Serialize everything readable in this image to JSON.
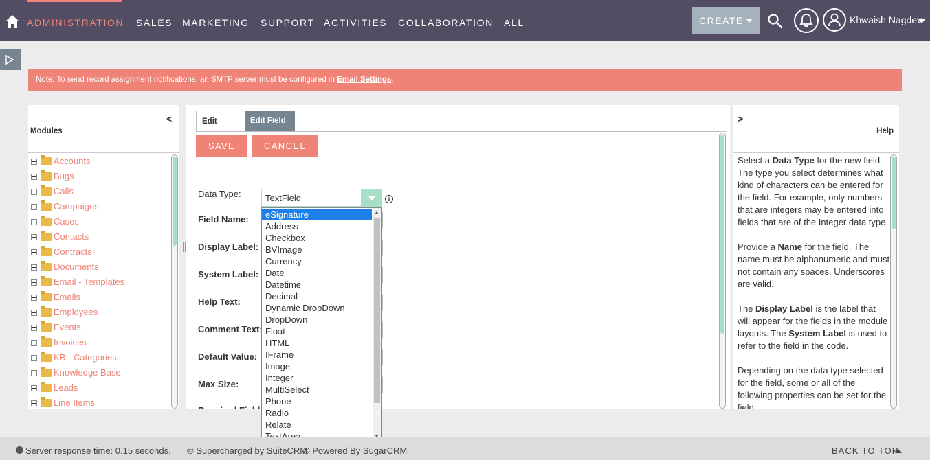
{
  "nav": {
    "items": [
      "ADMINISTRATION",
      "SALES",
      "MARKETING",
      "SUPPORT",
      "ACTIVITIES",
      "COLLABORATION",
      "ALL"
    ],
    "active": "ADMINISTRATION",
    "create_label": "CREATE",
    "user_name": "Khwaish Nagdev"
  },
  "notice": {
    "text": "Note: To send record assignment notifications, an SMTP server must be configured in ",
    "link": "Email Settings",
    "suffix": "."
  },
  "modules": {
    "collapse_glyph": "<",
    "title": "Modules",
    "items": [
      "Accounts",
      "Bugs",
      "Calls",
      "Campaigns",
      "Cases",
      "Contacts",
      "Contracts",
      "Documents",
      "Email - Templates",
      "Emails",
      "Employees",
      "Events",
      "Invoices",
      "KB - Categories",
      "Knowledge Base",
      "Leads",
      "Line Items"
    ]
  },
  "editor": {
    "tabs": [
      "Edit Fields",
      "Edit Field"
    ],
    "active_tab": "Edit Field",
    "save_label": "SAVE",
    "cancel_label": "CANCEL",
    "labels": {
      "data_type": "Data Type:",
      "field_name": "Field Name:",
      "display_label": "Display Label:",
      "system_label": "System Label:",
      "help_text": "Help Text:",
      "comment_text": "Comment Text:",
      "default_value": "Default Value:",
      "max_size": "Max Size:",
      "required_field": "Required Field:"
    },
    "data_type_value": "TextField",
    "info_glyph": "i",
    "dropdown_options": [
      "eSignature",
      "Address",
      "Checkbox",
      "BVImage",
      "Currency",
      "Date",
      "Datetime",
      "Decimal",
      "Dynamic DropDown",
      "DropDown",
      "Float",
      "HTML",
      "IFrame",
      "Image",
      "Integer",
      "MultiSelect",
      "Phone",
      "Radio",
      "Relate",
      "TextArea"
    ],
    "dropdown_highlighted": "eSignature"
  },
  "help": {
    "expand_glyph": ">",
    "title": "Help",
    "p1_a": "Select a ",
    "p1_b": "Data Type",
    "p1_c": " for the new field. The type you select determines what kind of characters can be entered for the field. For example, only numbers that are integers may be entered into fields that are of the Integer data type.",
    "p2_a": "Provide a ",
    "p2_b": "Name",
    "p2_c": " for the field. The name must be alphanumeric and must not contain any spaces. Underscores are valid.",
    "p3_a": "The ",
    "p3_b": "Display Label",
    "p3_c": " is the label that will appear for the fields in the module layouts. The ",
    "p3_d": "System Label",
    "p3_e": " is used to refer to the field in the code.",
    "p4": "Depending on the data type selected for the field, some or all of the following properties can be set for the field:"
  },
  "footer": {
    "response": "Server response time: 0.15 seconds.",
    "supercharged": "© Supercharged by SuiteCRM",
    "powered": "© Powered By SugarCRM",
    "back_to_top": "BACK TO TOP"
  },
  "colors": {
    "nav_bg": "#534d64",
    "accent": "#f08377",
    "teal": "#a6e0c8",
    "selection": "#1e7fe6"
  }
}
